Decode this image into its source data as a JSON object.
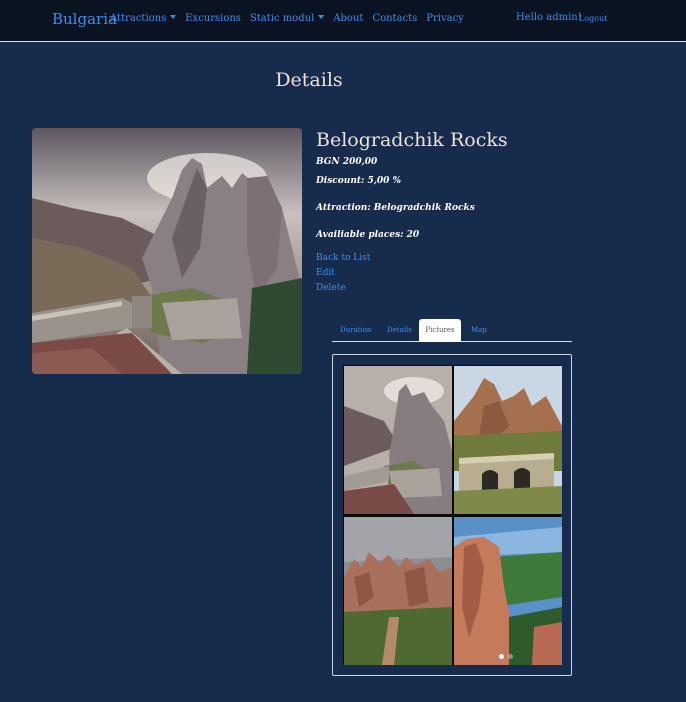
{
  "navbar": {
    "brand": "Bulgaria",
    "items": [
      {
        "label": "Attractions",
        "dropdown": true
      },
      {
        "label": "Excursions",
        "dropdown": false
      },
      {
        "label": "Static modul",
        "dropdown": true
      },
      {
        "label": "About",
        "dropdown": false
      },
      {
        "label": "Contacts",
        "dropdown": false
      },
      {
        "label": "Privacy",
        "dropdown": false
      }
    ],
    "greeting": "Hello admin!",
    "logout": "Logout"
  },
  "page": {
    "title": "Details"
  },
  "attraction": {
    "name": "Belogradchik Rocks",
    "price": "BGN 200,00",
    "discount": "Discount: 5,00 %",
    "attraction_line": "Attraction: Belogradchik Rocks",
    "places": "Availiable places: 20"
  },
  "actions": {
    "back": "Back to List",
    "edit": "Edit",
    "delete": "Delete"
  },
  "tabs": [
    {
      "label": "Duration",
      "active": false
    },
    {
      "label": "Details",
      "active": false
    },
    {
      "label": "Pictures",
      "active": true
    },
    {
      "label": "Map",
      "active": false
    }
  ],
  "colors": {
    "background": "#172b4d",
    "navbar": "#0a1322",
    "link": "#3f8ef0",
    "heading": "#ece2d6"
  },
  "icons": {
    "dropdown": "chevron-down-icon"
  }
}
